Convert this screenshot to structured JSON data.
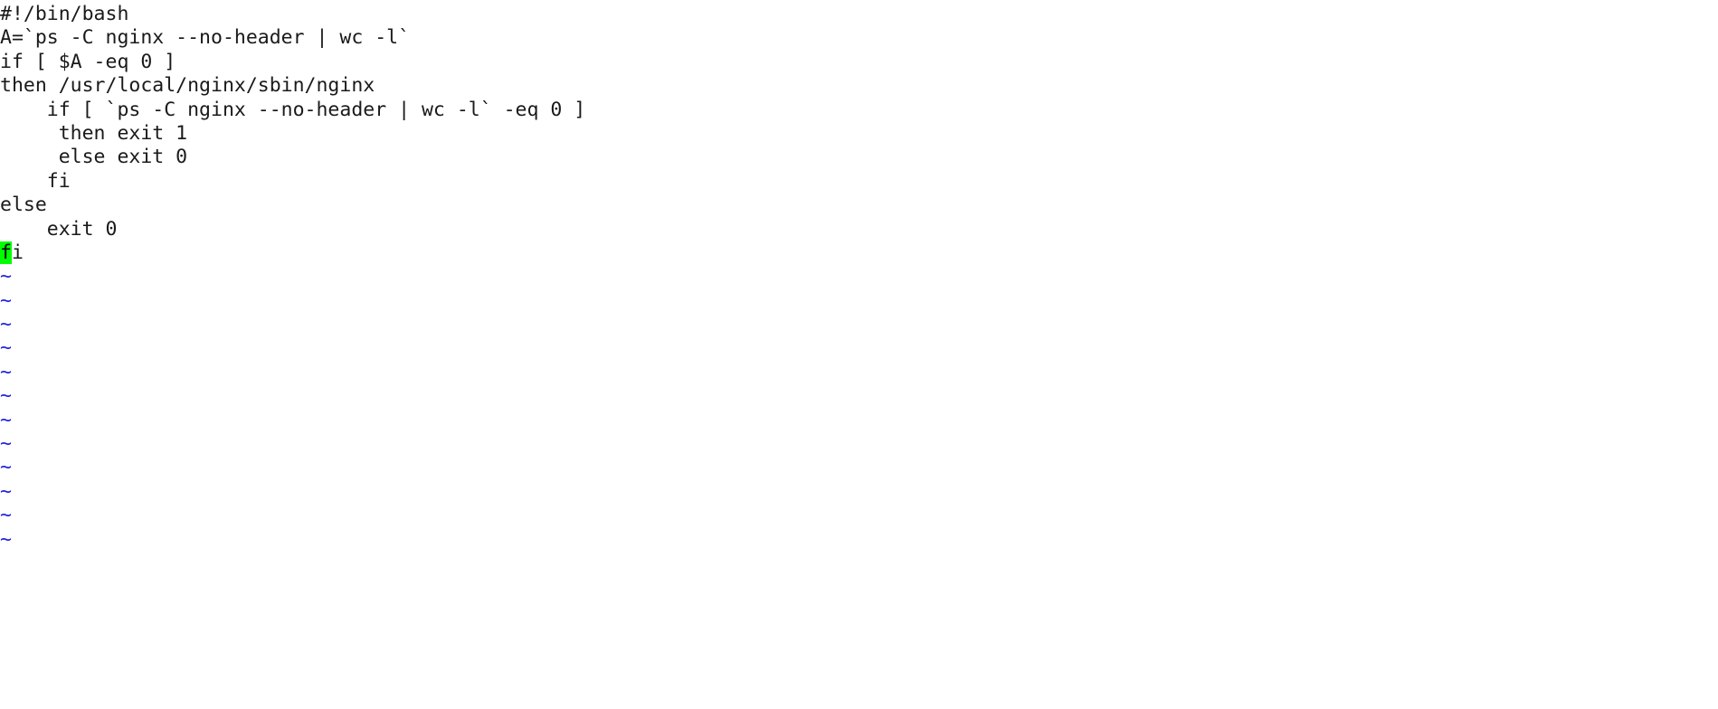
{
  "editor": {
    "kind": "vim-text-editor",
    "background_color": "#ffffff",
    "text_color": "#1a1a1a",
    "tilde_color": "#2222dd",
    "cursor_background_color": "#00ff00",
    "cursor_text_color": "#000000",
    "filler_char": "~"
  },
  "buffer": {
    "lines": [
      {
        "n": 1,
        "text": "#!/bin/bash"
      },
      {
        "n": 2,
        "text": "A=`ps -C nginx --no-header | wc -l`"
      },
      {
        "n": 3,
        "text": "if [ $A -eq 0 ]"
      },
      {
        "n": 4,
        "text": "then /usr/local/nginx/sbin/nginx"
      },
      {
        "n": 5,
        "text": "    if [ `ps -C nginx --no-header | wc -l` -eq 0 ]"
      },
      {
        "n": 6,
        "text": "     then exit 1"
      },
      {
        "n": 7,
        "text": "     else exit 0"
      },
      {
        "n": 8,
        "text": "    fi"
      },
      {
        "n": 9,
        "text": "else"
      },
      {
        "n": 10,
        "text": "    exit 0"
      }
    ],
    "cursor_line": {
      "n": 11,
      "cursor_char": "f",
      "rest": "i"
    },
    "filler_lines": [
      "~",
      "~",
      "~",
      "~",
      "~",
      "~",
      "~",
      "~",
      "~",
      "~",
      "~",
      "~"
    ]
  }
}
